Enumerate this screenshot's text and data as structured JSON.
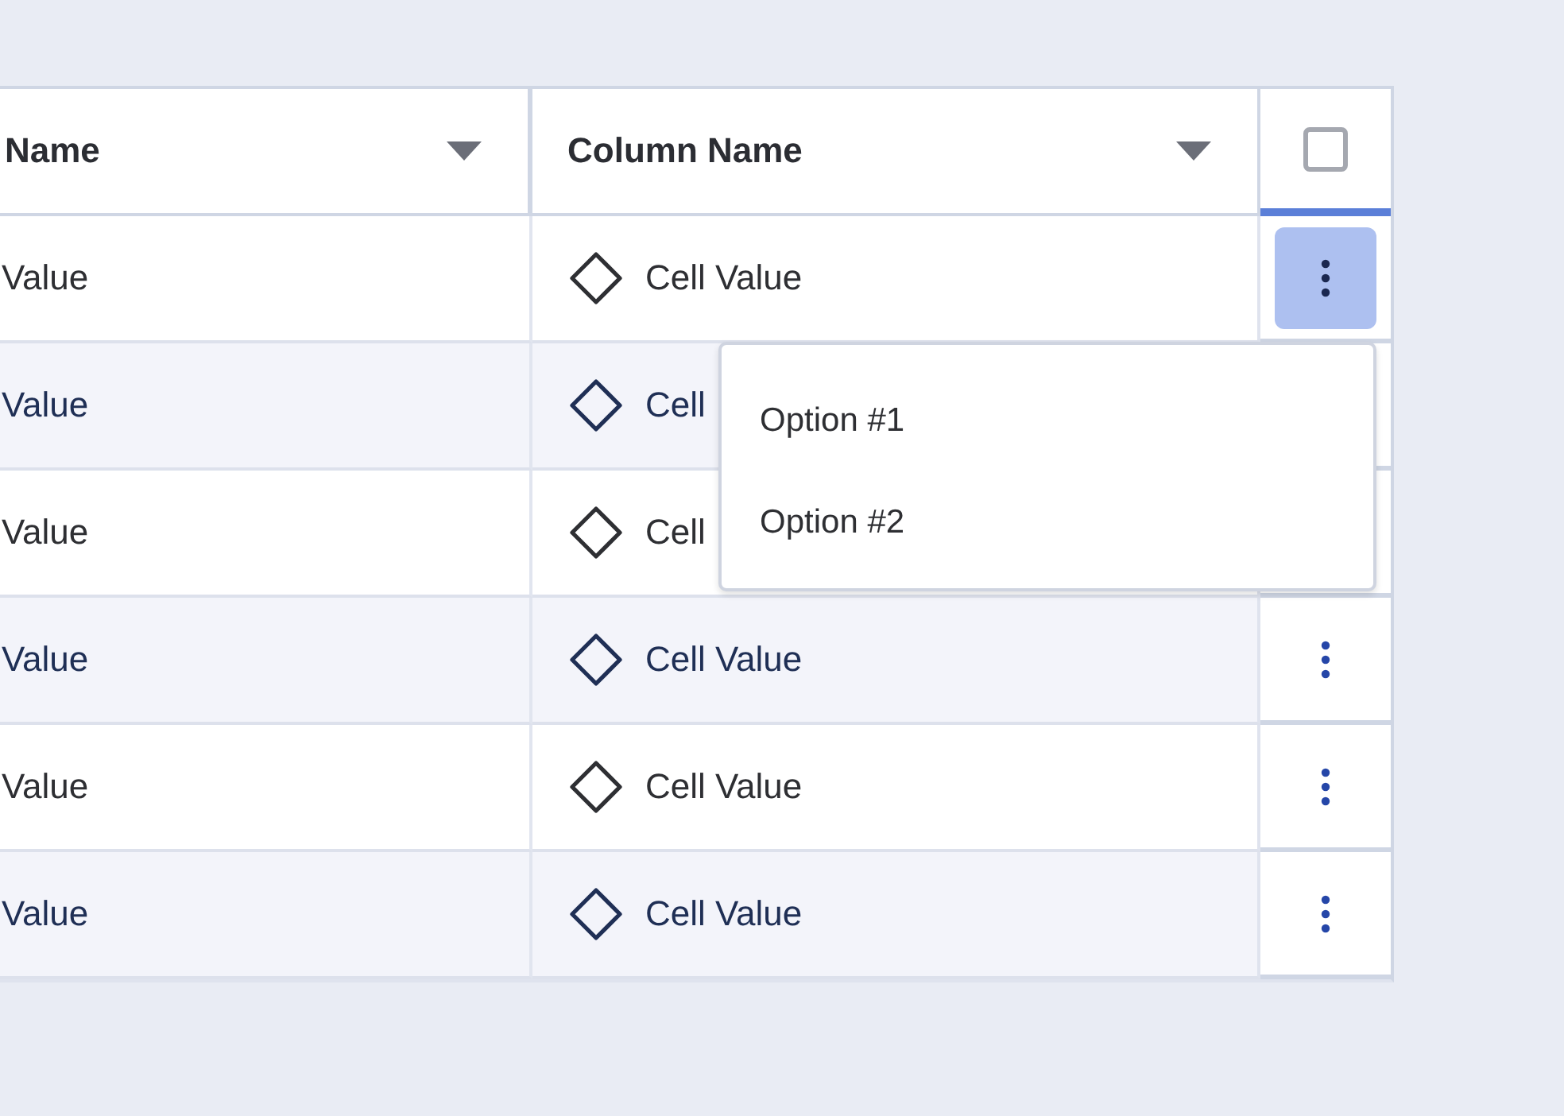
{
  "table": {
    "columns": [
      {
        "label": "Name"
      },
      {
        "label": "Column Name"
      }
    ],
    "select_all": {
      "checked": false
    },
    "rows": [
      {
        "cells": [
          "Value",
          "Cell Value"
        ],
        "menu_open": true
      },
      {
        "cells": [
          "Value",
          "Cell"
        ]
      },
      {
        "cells": [
          "Value",
          "Cell"
        ]
      },
      {
        "cells": [
          "Value",
          "Cell Value"
        ],
        "menu_open": false
      },
      {
        "cells": [
          "Value",
          "Cell Value"
        ],
        "menu_open": false
      },
      {
        "cells": [
          "Value",
          "Cell Value"
        ],
        "menu_open": false
      }
    ]
  },
  "row_menu": {
    "options": [
      "Option #1",
      "Option #2"
    ]
  }
}
